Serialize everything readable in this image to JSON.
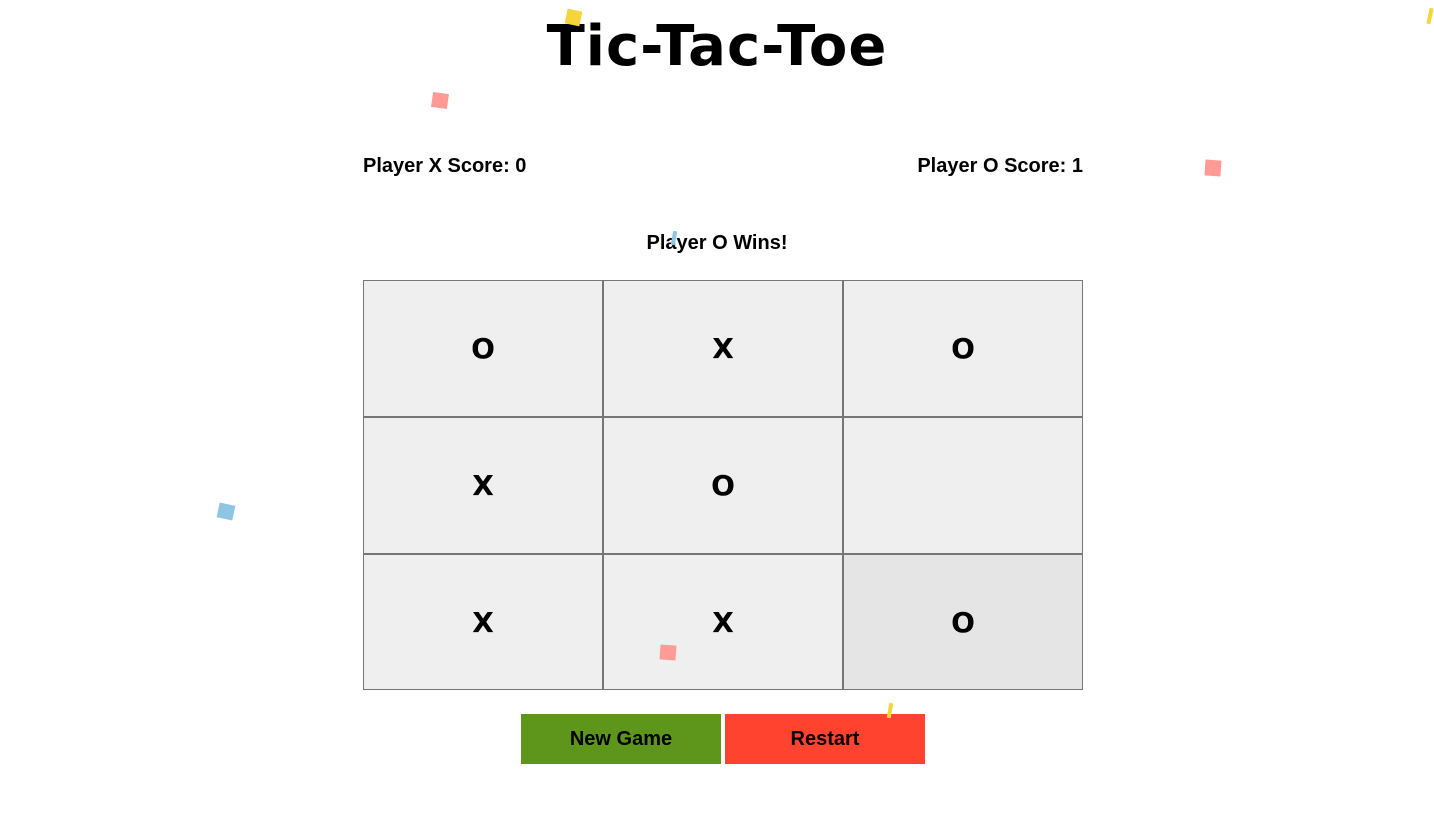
{
  "game": {
    "title": "Tic-Tac-Toe",
    "score_x": "Player X Score: 0",
    "score_o": "Player O Score: 1",
    "status": "Player O Wins!",
    "board": [
      "O",
      "X",
      "O",
      "X",
      "O",
      "",
      "X",
      "X",
      "O"
    ]
  },
  "buttons": {
    "new_game": "New Game",
    "restart": "Restart"
  },
  "colors": {
    "new_game_bg": "#5e951b",
    "restart_bg": "#ff432e",
    "cell_bg": "#efefef",
    "cell_hover_bg": "#e5e5e5",
    "confetti_yellow": "#f5d53a",
    "confetti_pink": "#ff9a94",
    "confetti_blue": "#8ec5e2"
  }
}
